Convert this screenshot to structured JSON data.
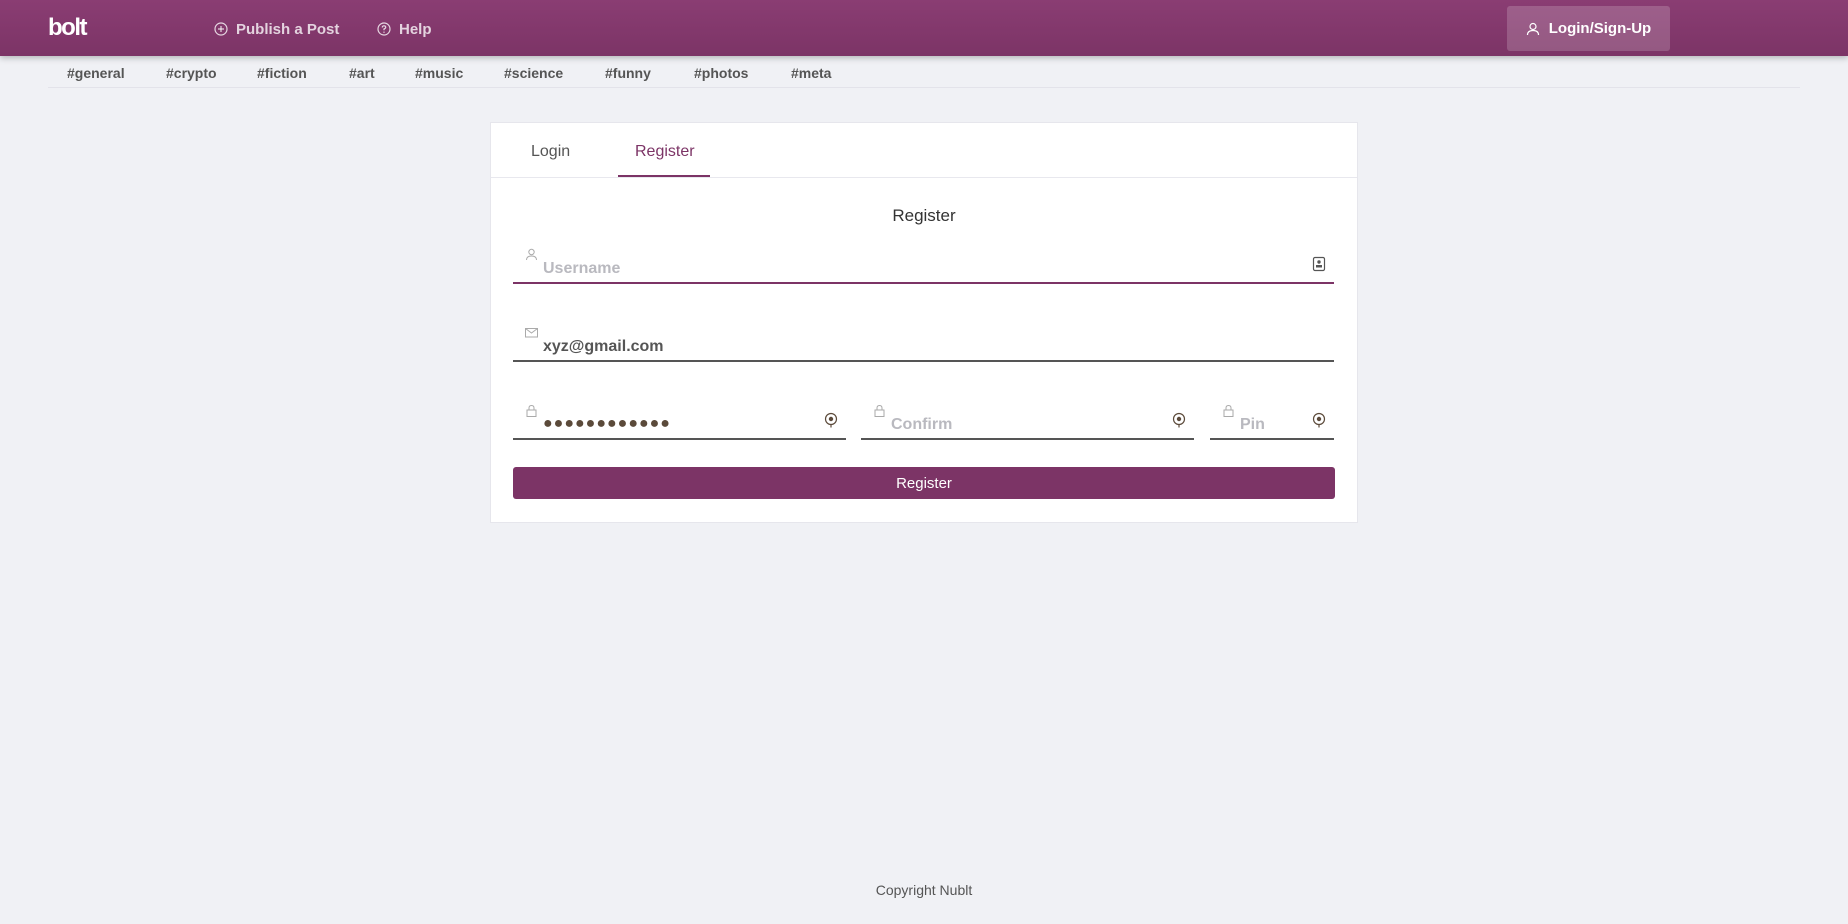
{
  "header": {
    "logo": "bolt",
    "publish_label": "Publish a Post",
    "help_label": "Help",
    "login_label": "Login/Sign-Up"
  },
  "tags": [
    "#general",
    "#crypto",
    "#fiction",
    "#art",
    "#music",
    "#science",
    "#funny",
    "#photos",
    "#meta"
  ],
  "auth": {
    "tabs": {
      "login": "Login",
      "register": "Register"
    },
    "active_tab": "Register",
    "title": "Register",
    "username": {
      "placeholder": "Username",
      "value": ""
    },
    "email": {
      "value": "xyz@gmail.com"
    },
    "password": {
      "masked_value": "●●●●●●●●●●●●"
    },
    "confirm": {
      "placeholder": "Confirm"
    },
    "pin": {
      "placeholder": "Pin"
    },
    "submit_label": "Register"
  },
  "footer": {
    "copyright": "Copyright Nublt"
  },
  "colors": {
    "brand": "#7c3466",
    "background": "#f0f1f5"
  }
}
